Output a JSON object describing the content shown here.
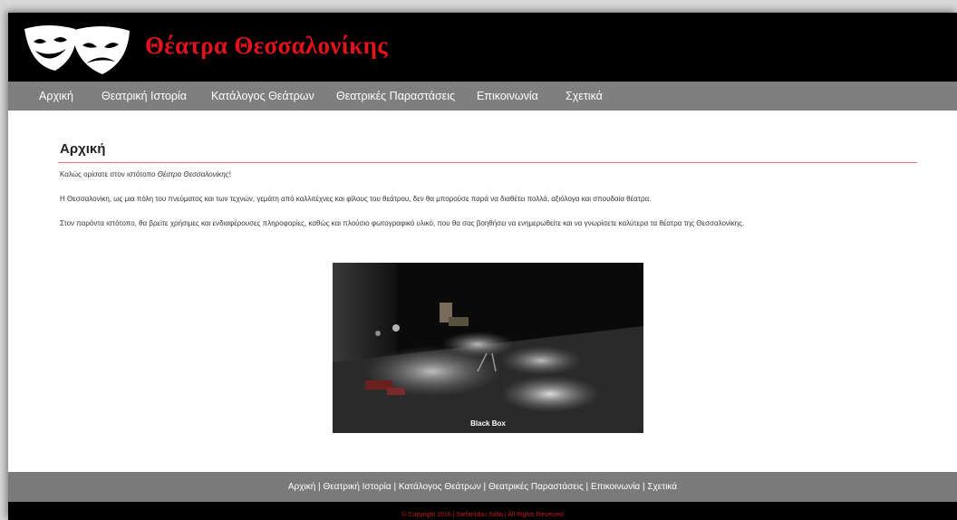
{
  "header": {
    "site_title": "Θέατρα Θεσσαλονίκης",
    "logo_icon": "theater-masks-icon"
  },
  "nav": {
    "items": [
      {
        "label": "Αρχική"
      },
      {
        "label": "Θεατρική Ιστορία"
      },
      {
        "label": "Κατάλογος Θεάτρων"
      },
      {
        "label": "Θεατρικές Παραστάσεις"
      },
      {
        "label": "Επικοινωνία"
      },
      {
        "label": "Σχετικά"
      }
    ]
  },
  "main": {
    "title": "Αρχική",
    "para1_prefix": "Καλώς ορίσατε στον ιστότοπο ",
    "para1_emphasis": "Θέατρα Θεσσαλονίκης",
    "para1_suffix": "!",
    "para2": "Η Θεσσαλονίκη, ως μια πόλη του πνεύματος και των τεχνών, γεμάτη από καλλιτέχνες και φίλους του θεάτρου, δεν θα μπορούσε παρά να διαθέτει πολλά, αξιόλογα και σπουδαία θέατρα.",
    "para3": "Στον παρόντα ιστότοπο, θα βρείτε χρήσιμες και ενδιαφέρουσες πληροφορίες, καθώς και πλούσιο φωτογραφικό υλικό, που θα σας βοηθήσει να ενημερωθείτε και να γνωρίσετε καλύτερα τα θέατρα της Θεσσαλονίκης.",
    "photo_caption": "Black Box"
  },
  "footer": {
    "links": [
      "Αρχική",
      "Θεατρική Ιστορία",
      "Κατάλογος Θεάτρων",
      "Θεατρικές Παραστάσεις",
      "Επικοινωνία",
      "Σχετικά"
    ],
    "separator": " | ",
    "copyright": "© Copyright 2016 | Stefanidou Sofia | All Rights Reserved"
  },
  "colors": {
    "brand_red": "#e3121e",
    "nav_gray": "#7f7f7f",
    "rule_red": "#e07878"
  }
}
